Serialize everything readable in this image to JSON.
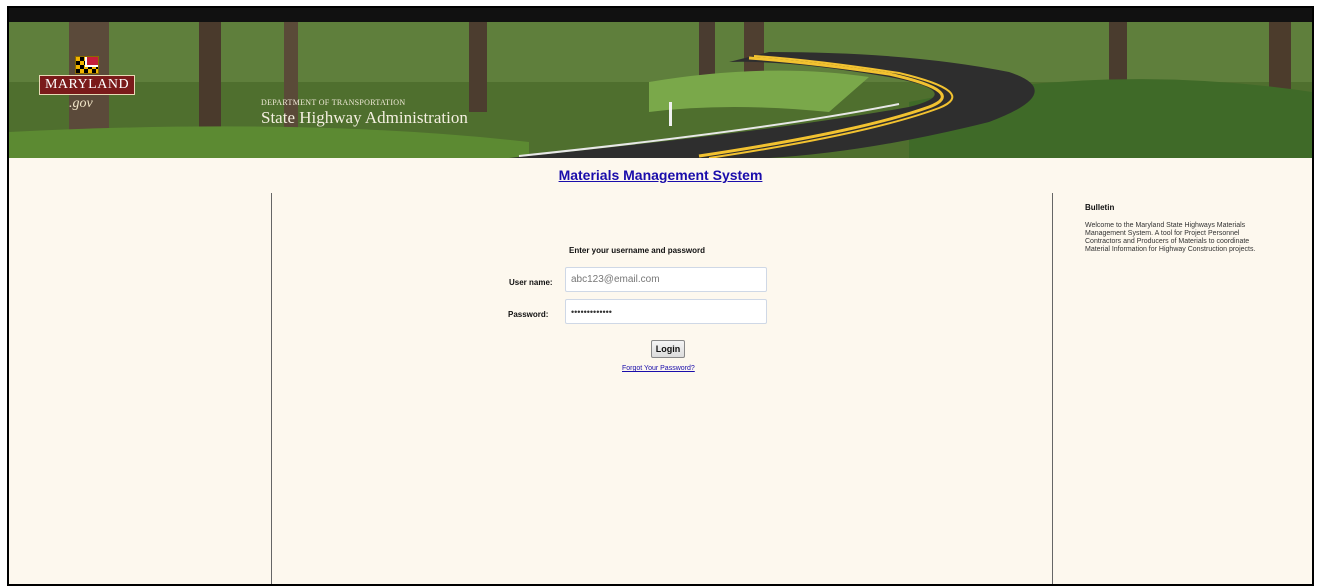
{
  "header": {
    "logo_word": "MARYLAND",
    "logo_gov": ".gov",
    "department": "DEPARTMENT OF TRANSPORTATION",
    "agency": "State Highway Administration"
  },
  "main": {
    "title": "Materials Management System",
    "prompt": "Enter your username and password",
    "username_label": "User name:",
    "username_value": "abc123@email.com",
    "password_label": "Password:",
    "password_value": "•••••••••••••",
    "login_label": "Login",
    "forgot_label": "Forgot Your Password?"
  },
  "bulletin": {
    "title": "Bulletin",
    "text": "Welcome to the Maryland State Highways Materials Management System. A tool for Project Personnel Contractors and Producers of Materials to coordinate Material Information for Highway Construction projects."
  },
  "colors": {
    "page_bg": "#fdf8ee",
    "link": "#1a0dab",
    "logo_red": "#7a1a1a",
    "road_line": "#f2c230"
  }
}
